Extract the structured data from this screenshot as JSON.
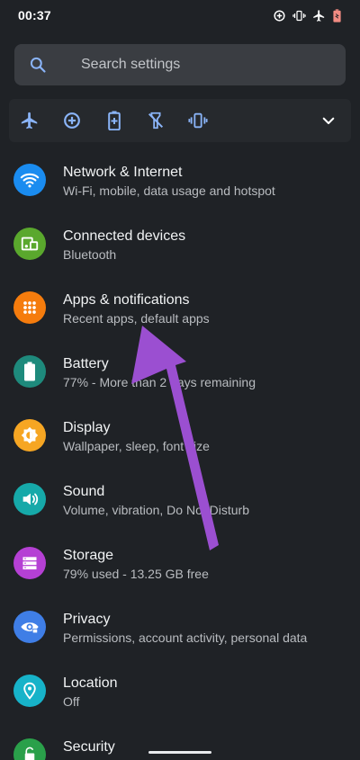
{
  "status_bar": {
    "time": "00:37"
  },
  "search": {
    "placeholder": "Search settings"
  },
  "quick_tiles": [
    "airplane-mode",
    "data-saver",
    "battery-saver",
    "flashlight-off",
    "vibrate"
  ],
  "colors": {
    "background": "#1f2226",
    "accent_blue": "#8ab4f8",
    "arrow": "#9b4fd1"
  },
  "settings": [
    {
      "title": "Network & Internet",
      "subtitle": "Wi-Fi, mobile, data usage and hotspot",
      "icon": "wifi-icon",
      "color": "#1a8cf0"
    },
    {
      "title": "Connected devices",
      "subtitle": "Bluetooth",
      "icon": "devices-icon",
      "color": "#5aa82d"
    },
    {
      "title": "Apps & notifications",
      "subtitle": "Recent apps, default apps",
      "icon": "apps-icon",
      "color": "#f57c0d"
    },
    {
      "title": "Battery",
      "subtitle": "77% - More than 2 days remaining",
      "icon": "battery-icon",
      "color": "#1e8a7c"
    },
    {
      "title": "Display",
      "subtitle": "Wallpaper, sleep, font size",
      "icon": "brightness-icon",
      "color": "#f6a623"
    },
    {
      "title": "Sound",
      "subtitle": "Volume, vibration, Do Not Disturb",
      "icon": "volume-icon",
      "color": "#16a9a9"
    },
    {
      "title": "Storage",
      "subtitle": "79% used - 13.25 GB free",
      "icon": "storage-icon",
      "color": "#b540d4"
    },
    {
      "title": "Privacy",
      "subtitle": "Permissions, account activity, personal data",
      "icon": "eye-icon",
      "color": "#3f7ee6"
    },
    {
      "title": "Location",
      "subtitle": "Off",
      "icon": "location-icon",
      "color": "#17b3c9"
    },
    {
      "title": "Security",
      "subtitle": "",
      "icon": "lock-icon",
      "color": "#2aa04a"
    }
  ]
}
